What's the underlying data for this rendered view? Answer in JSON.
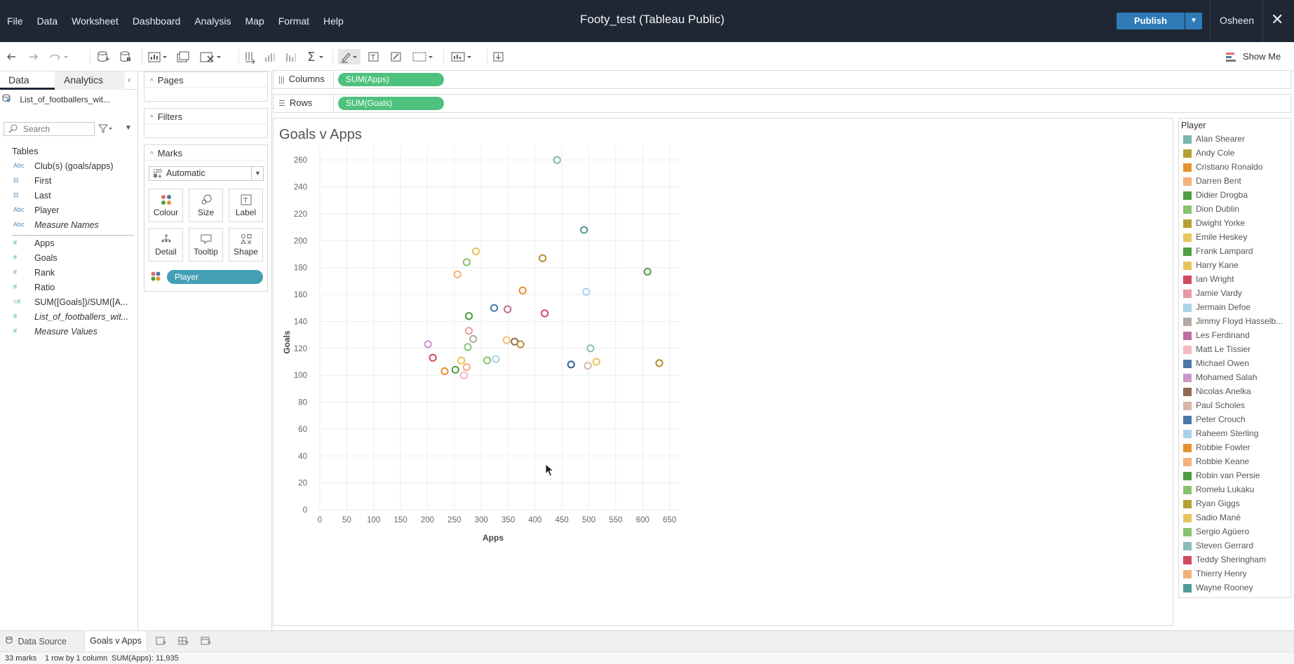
{
  "app": {
    "title": "Footy_test (Tableau Public)",
    "menu": [
      "File",
      "Data",
      "Worksheet",
      "Dashboard",
      "Analysis",
      "Map",
      "Format",
      "Help"
    ],
    "publish_label": "Publish",
    "user": "Osheen",
    "close_glyph": "✕"
  },
  "toolbar": {
    "show_me_label": "Show Me"
  },
  "data_pane": {
    "tab_data": "Data",
    "tab_analytics": "Analytics",
    "collapse_glyph": "‹",
    "datasource": "List_of_footballers_wit...",
    "search_placeholder": "Search",
    "tables_heading": "Tables",
    "dimensions": [
      {
        "type": "Abc",
        "name": "Club(s) (goals/apps)"
      },
      {
        "type": "⊟",
        "name": "First"
      },
      {
        "type": "⊟",
        "name": "Last"
      },
      {
        "type": "Abc",
        "name": "Player"
      },
      {
        "type": "Abc",
        "name": "Measure Names"
      }
    ],
    "measures": [
      {
        "type": "#",
        "name": "Apps"
      },
      {
        "type": "#",
        "name": "Goals"
      },
      {
        "type": "#",
        "name": "Rank"
      },
      {
        "type": "#",
        "name": "Ratio"
      },
      {
        "type": "=#",
        "name": "SUM([Goals])/SUM([A..."
      },
      {
        "type": "#",
        "name": "List_of_footballers_wit..."
      },
      {
        "type": "#",
        "name": "Measure Values"
      }
    ]
  },
  "cards": {
    "pages": "Pages",
    "filters": "Filters",
    "marks": "Marks",
    "mark_type": "Automatic",
    "buttons": [
      "Colour",
      "Size",
      "Label",
      "Detail",
      "Tooltip",
      "Shape"
    ],
    "color_pill": "Player"
  },
  "shelves": {
    "columns_label": "Columns",
    "columns_pill": "SUM(Apps)",
    "rows_label": "Rows",
    "rows_pill": "SUM(Goals)"
  },
  "chart_data": {
    "type": "scatter",
    "title": "Goals v Apps",
    "xlabel": "Apps",
    "ylabel": "Goals",
    "xlim": [
      0,
      670
    ],
    "ylim": [
      0,
      270
    ],
    "x_ticks": [
      0,
      50,
      100,
      150,
      200,
      250,
      300,
      350,
      400,
      450,
      500,
      550,
      600,
      650
    ],
    "y_ticks": [
      0,
      20,
      40,
      60,
      80,
      100,
      120,
      140,
      160,
      180,
      200,
      220,
      240,
      260
    ],
    "grid": true,
    "legend_position": "right",
    "points": [
      {
        "x": 441,
        "y": 260,
        "color": "#7ab6b0"
      },
      {
        "x": 491,
        "y": 208,
        "color": "#4e9a9a"
      },
      {
        "x": 609,
        "y": 177,
        "color": "#4f9e45"
      },
      {
        "x": 414,
        "y": 187,
        "color": "#b5932b"
      },
      {
        "x": 290,
        "y": 192,
        "color": "#e8c55a"
      },
      {
        "x": 273,
        "y": 184,
        "color": "#86c46f"
      },
      {
        "x": 256,
        "y": 175,
        "color": "#f2b27a"
      },
      {
        "x": 377,
        "y": 163,
        "color": "#e7902f"
      },
      {
        "x": 495,
        "y": 162,
        "color": "#a8d3e8"
      },
      {
        "x": 324,
        "y": 150,
        "color": "#4c78a8"
      },
      {
        "x": 349,
        "y": 149,
        "color": "#c06c9b"
      },
      {
        "x": 418,
        "y": 146,
        "color": "#d14a5e"
      },
      {
        "x": 277,
        "y": 144,
        "color": "#4f9e45"
      },
      {
        "x": 277,
        "y": 133,
        "color": "#e99aa0"
      },
      {
        "x": 285,
        "y": 127,
        "color": "#b5a8a5"
      },
      {
        "x": 347,
        "y": 126,
        "color": "#f2c27a"
      },
      {
        "x": 362,
        "y": 125,
        "color": "#8f6b52"
      },
      {
        "x": 373,
        "y": 123,
        "color": "#b5932b"
      },
      {
        "x": 201,
        "y": 123,
        "color": "#c899c6"
      },
      {
        "x": 275,
        "y": 121,
        "color": "#86c46f"
      },
      {
        "x": 503,
        "y": 120,
        "color": "#88bdb8"
      },
      {
        "x": 210,
        "y": 113,
        "color": "#d14a5e"
      },
      {
        "x": 327,
        "y": 112,
        "color": "#a8d3e8"
      },
      {
        "x": 311,
        "y": 111,
        "color": "#86c46f"
      },
      {
        "x": 263,
        "y": 111,
        "color": "#e8c55a"
      },
      {
        "x": 514,
        "y": 110,
        "color": "#e8c55a"
      },
      {
        "x": 631,
        "y": 109,
        "color": "#b5932b"
      },
      {
        "x": 467,
        "y": 108,
        "color": "#2f5f8f"
      },
      {
        "x": 498,
        "y": 107,
        "color": "#d8b5a8"
      },
      {
        "x": 273,
        "y": 106,
        "color": "#f2b27a"
      },
      {
        "x": 252,
        "y": 104,
        "color": "#4f9e45"
      },
      {
        "x": 232,
        "y": 103,
        "color": "#e7902f"
      },
      {
        "x": 268,
        "y": 100,
        "color": "#f4b7c4"
      }
    ]
  },
  "legend": {
    "title": "Player",
    "items": [
      {
        "name": "Alan Shearer",
        "color": "#7ab6b0"
      },
      {
        "name": "Andy Cole",
        "color": "#b5a033"
      },
      {
        "name": "Cristiano Ronaldo",
        "color": "#e7902f"
      },
      {
        "name": "Darren Bent",
        "color": "#f2b27a"
      },
      {
        "name": "Didier Drogba",
        "color": "#4f9e45"
      },
      {
        "name": "Dion Dublin",
        "color": "#86c46f"
      },
      {
        "name": "Dwight Yorke",
        "color": "#b5a033"
      },
      {
        "name": "Emile Heskey",
        "color": "#e8c55a"
      },
      {
        "name": "Frank Lampard",
        "color": "#4f9e45"
      },
      {
        "name": "Harry Kane",
        "color": "#e8c55a"
      },
      {
        "name": "Ian Wright",
        "color": "#d14a5e"
      },
      {
        "name": "Jamie Vardy",
        "color": "#e99aa0"
      },
      {
        "name": "Jermain Defoe",
        "color": "#a8d3e8"
      },
      {
        "name": "Jimmy Floyd Hasselb...",
        "color": "#b5a8a5"
      },
      {
        "name": "Les Ferdinand",
        "color": "#c06c9b"
      },
      {
        "name": "Matt Le Tissier",
        "color": "#f4b7c4"
      },
      {
        "name": "Michael Owen",
        "color": "#4c78a8"
      },
      {
        "name": "Mohamed Salah",
        "color": "#c899c6"
      },
      {
        "name": "Nicolas Anelka",
        "color": "#8f6b52"
      },
      {
        "name": "Paul Scholes",
        "color": "#d8b5a8"
      },
      {
        "name": "Peter Crouch",
        "color": "#4c78a8"
      },
      {
        "name": "Raheem Sterling",
        "color": "#a8d3e8"
      },
      {
        "name": "Robbie Fowler",
        "color": "#e7902f"
      },
      {
        "name": "Robbie Keane",
        "color": "#f2b27a"
      },
      {
        "name": "Robin van Persie",
        "color": "#4f9e45"
      },
      {
        "name": "Romelu Lukaku",
        "color": "#86c46f"
      },
      {
        "name": "Ryan Giggs",
        "color": "#b5a033"
      },
      {
        "name": "Sadio Mané",
        "color": "#e8c55a"
      },
      {
        "name": "Sergio Agüero",
        "color": "#86c46f"
      },
      {
        "name": "Steven Gerrard",
        "color": "#88bdb8"
      },
      {
        "name": "Teddy Sheringham",
        "color": "#d14a5e"
      },
      {
        "name": "Thierry Henry",
        "color": "#f2b27a"
      },
      {
        "name": "Wayne Rooney",
        "color": "#4e9a9a"
      }
    ]
  },
  "sheet_tabs": {
    "datasource": "Data Source",
    "active": "Goals v Apps"
  },
  "status": {
    "marks": "33 marks",
    "rows_cols": "1 row by 1 column",
    "sum": "SUM(Apps): 11,935"
  }
}
